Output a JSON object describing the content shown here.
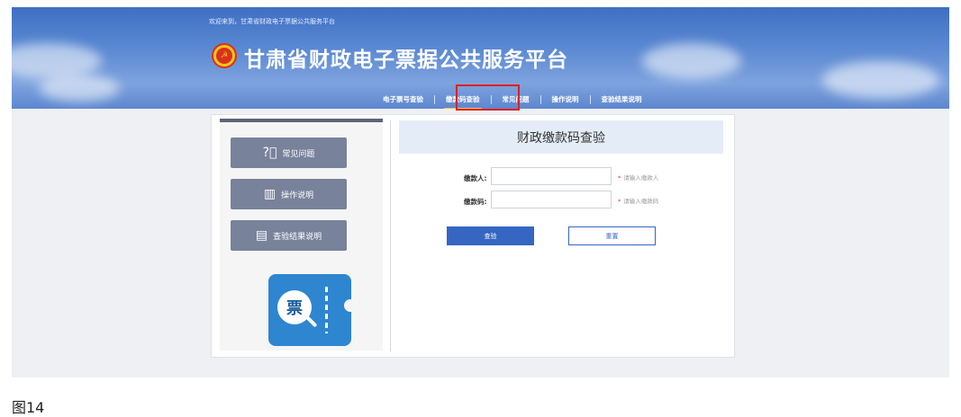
{
  "header": {
    "welcome": "欢迎来到，甘肃省财政电子票据公共服务平台",
    "title": "甘肃省财政电子票据公共服务平台",
    "logo_icon": "party-emblem-icon"
  },
  "nav": {
    "items": [
      {
        "label": "电子票号查验"
      },
      {
        "label": "缴款码查验",
        "active": true
      },
      {
        "label": "常见问题"
      },
      {
        "label": "操作说明"
      },
      {
        "label": "查验结果说明"
      }
    ]
  },
  "sidebar": {
    "buttons": [
      {
        "label": "常见问题",
        "icon": "question-circle-icon"
      },
      {
        "label": "操作说明",
        "icon": "chart-book-icon"
      },
      {
        "label": "查验结果说明",
        "icon": "document-icon"
      }
    ],
    "ticket_glyph": "票"
  },
  "form": {
    "title": "财政缴款码查验",
    "payer_label": "缴款人:",
    "payer_value": "",
    "payer_hint": "请输入缴款人",
    "code_label": "缴款码:",
    "code_value": "",
    "code_hint": "请输入缴款码",
    "required_mark": "*",
    "check_label": "查验",
    "reset_label": "重置"
  },
  "caption": "图14",
  "colors": {
    "primary": "#3566c2",
    "sidebar_button": "#78829b",
    "highlight_box": "#e02020",
    "active_underline": "#f5c242"
  }
}
